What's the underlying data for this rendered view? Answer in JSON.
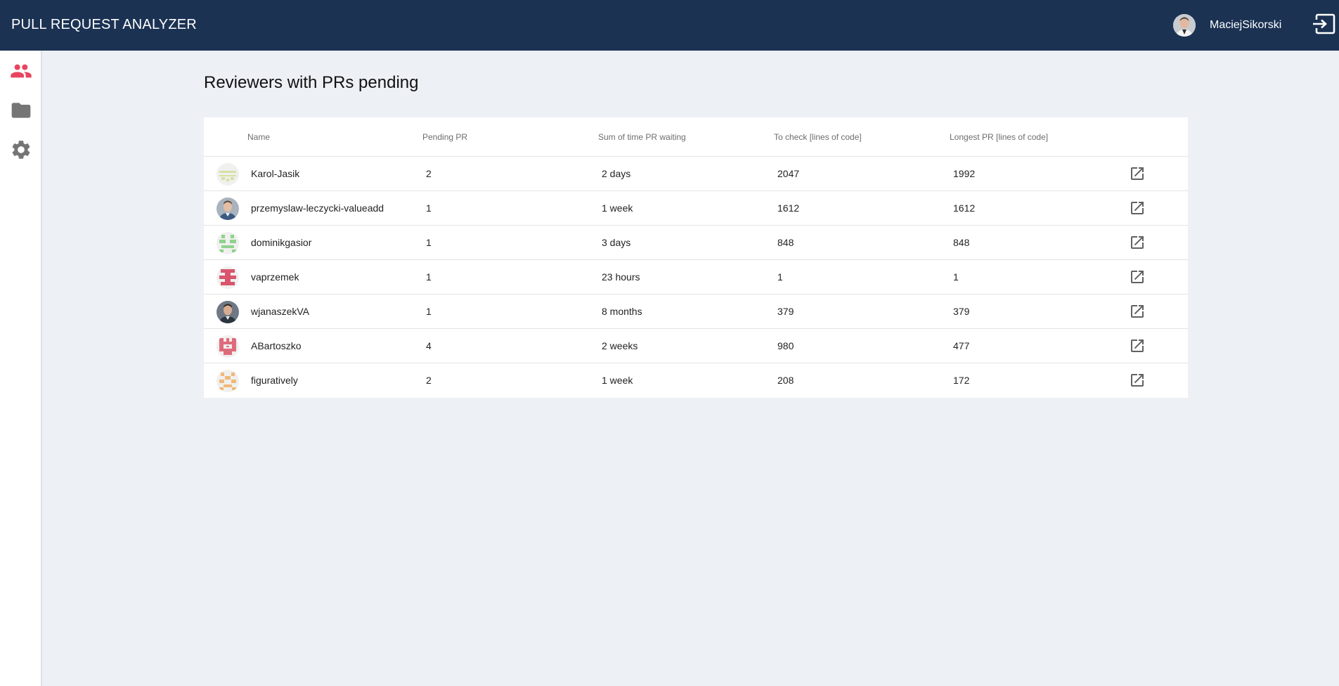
{
  "app": {
    "title": "PULL REQUEST ANALYZER"
  },
  "user": {
    "name": "MaciejSikorski"
  },
  "sidebar": {
    "items": [
      {
        "icon": "people-icon",
        "active": true
      },
      {
        "icon": "folder-icon",
        "active": false
      },
      {
        "icon": "gear-icon",
        "active": false
      }
    ]
  },
  "page": {
    "title": "Reviewers with PRs pending"
  },
  "table": {
    "headers": {
      "name": "Name",
      "pending": "Pending PR",
      "time": "Sum of time PR waiting",
      "to_check": "To check [lines of code]",
      "longest": "Longest PR [lines of code]"
    },
    "rows": [
      {
        "name": "Karol-Jasik",
        "pending": "2",
        "time": "2 days",
        "to_check": "2047",
        "longest": "1992"
      },
      {
        "name": "przemyslaw-leczycki-valueadd",
        "pending": "1",
        "time": "1 week",
        "to_check": "1612",
        "longest": "1612"
      },
      {
        "name": "dominikgasior",
        "pending": "1",
        "time": "3 days",
        "to_check": "848",
        "longest": "848"
      },
      {
        "name": "vaprzemek",
        "pending": "1",
        "time": "23 hours",
        "to_check": "1",
        "longest": "1"
      },
      {
        "name": "wjanaszekVA",
        "pending": "1",
        "time": "8 months",
        "to_check": "379",
        "longest": "379"
      },
      {
        "name": "ABartoszko",
        "pending": "4",
        "time": "2 weeks",
        "to_check": "980",
        "longest": "477"
      },
      {
        "name": "figuratively",
        "pending": "2",
        "time": "1 week",
        "to_check": "208",
        "longest": "172"
      }
    ]
  },
  "colors": {
    "header_bg": "#1b3253",
    "page_bg": "#edf0f4",
    "active_nav": "#e8445f",
    "nav_icon": "#757575"
  }
}
